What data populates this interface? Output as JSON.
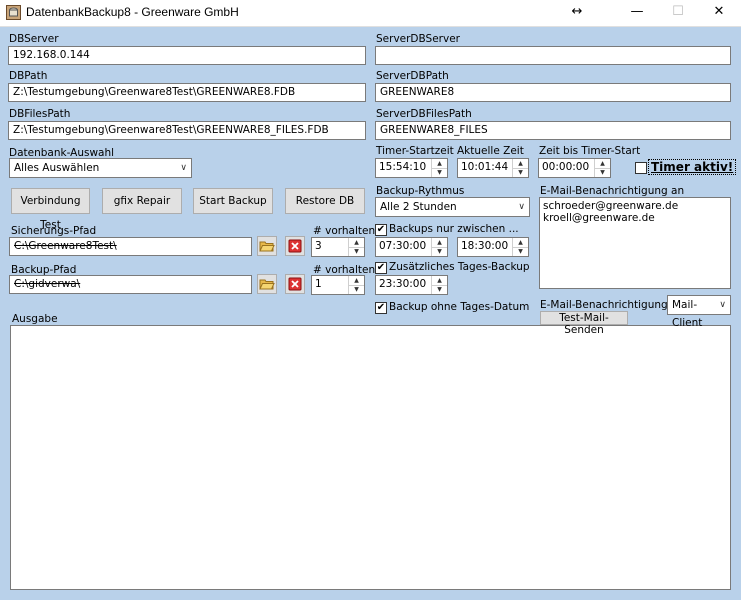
{
  "window": {
    "title": "DatenbankBackup8 - Greenware GmbH",
    "resize_glyph": "↔",
    "minimize": "—",
    "maximize": "☐",
    "close": "✕"
  },
  "left": {
    "dbserver_label": "DBServer",
    "dbserver_value": "192.168.0.144",
    "dbpath_label": "DBPath",
    "dbpath_value": "Z:\\Testumgebung\\Greenware8Test\\GREENWARE8.FDB",
    "dbfilespath_label": "DBFilesPath",
    "dbfilespath_value": "Z:\\Testumgebung\\Greenware8Test\\GREENWARE8_FILES.FDB",
    "db_auswahl_label": "Datenbank-Auswahl",
    "db_auswahl_value": "Alles Auswählen",
    "buttons": {
      "verbindung_test": "Verbindung Test",
      "gfix_repair": "gfix Repair",
      "start_backup": "Start Backup",
      "restore_db": "Restore DB"
    },
    "sicherungs_pfad_label": "Sicherungs-Pfad",
    "sicherungs_pfad_value": "C:\\Greenware8Test\\",
    "vorhalten_label_1": "# vorhalten",
    "vorhalten_value_1": "3",
    "backup_pfad_label": "Backup-Pfad",
    "backup_pfad_value": "C:\\gidverwa\\",
    "vorhalten_label_2": "# vorhalten",
    "vorhalten_value_2": "1",
    "ausgabe_label": "Ausgabe"
  },
  "right": {
    "serverdbserver_label": "ServerDBServer",
    "serverdbserver_value": "",
    "serverdbpath_label": "ServerDBPath",
    "serverdbpath_value": "GREENWARE8",
    "serverdbfilespath_label": "ServerDBFilesPath",
    "serverdbfilespath_value": "GREENWARE8_FILES",
    "timer_startzeit_label": "Timer-Startzeit",
    "timer_startzeit_value": "15:54:10",
    "aktuelle_zeit_label": "Aktuelle Zeit",
    "aktuelle_zeit_value": "10:01:44",
    "zeit_bis_label": "Zeit bis Timer-Start",
    "zeit_bis_value": "00:00:00",
    "timer_aktiv_label": "Timer aktiv!",
    "backup_rythmus_label": "Backup-Rythmus",
    "backup_rythmus_value": "Alle 2 Stunden",
    "backups_nur_zwischen_label": "Backups nur zwischen ...",
    "zwischen_von": "07:30:00",
    "zwischen_bis": "18:30:00",
    "zus_tages_backup_label": "Zusätzliches Tages-Backup",
    "zus_tages_backup_value": "23:30:00",
    "ohne_tagesdatum_label": "Backup ohne Tages-Datum",
    "email_label": "E-Mail-Benachrichtigung an",
    "email_1": "schroeder@greenware.de",
    "email_2": "kroell@greenware.de",
    "email_per_label": "E-Mail-Benachrichtigung per",
    "email_per_value": "Mail-Client",
    "test_mail_button": "Test-Mail-Senden"
  },
  "icons": {
    "app": "database-app-icon",
    "folder": "folder-open-icon",
    "delete": "red-x-delete-icon"
  }
}
